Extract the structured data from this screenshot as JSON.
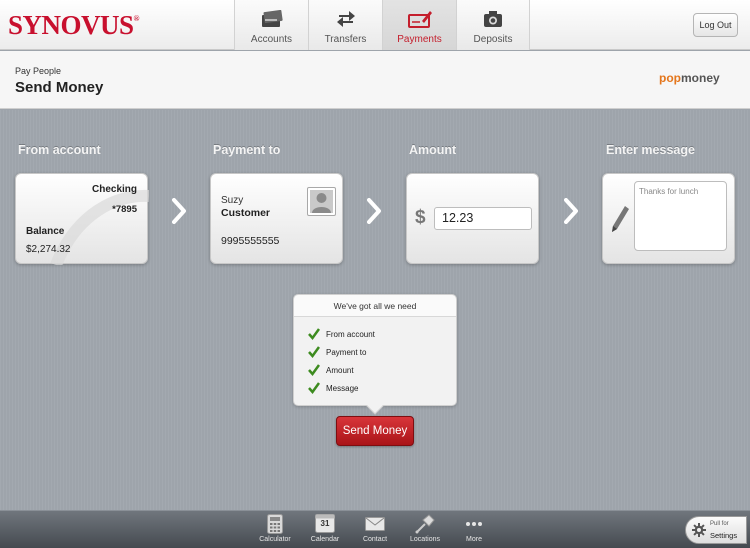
{
  "brand": {
    "logo": "SYNOVUS",
    "logo_mark": "®",
    "partner_logo_a": "pop",
    "partner_logo_b": "money"
  },
  "tabs": [
    {
      "label": "Accounts",
      "icon": "wallet-icon"
    },
    {
      "label": "Transfers",
      "icon": "transfer-arrows-icon"
    },
    {
      "label": "Payments",
      "icon": "check-pencil-icon",
      "active": true
    },
    {
      "label": "Deposits",
      "icon": "camera-icon"
    }
  ],
  "logout_label": "Log Out",
  "header": {
    "breadcrumb": "Pay People",
    "title": "Send Money"
  },
  "columns": {
    "from_label": "From account",
    "to_label": "Payment to",
    "amount_label": "Amount",
    "message_label": "Enter message"
  },
  "from_account": {
    "type": "Checking",
    "number": "*7895",
    "balance_label": "Balance",
    "balance": "$2,274.32"
  },
  "payee": {
    "first": "Suzy",
    "last": "Customer",
    "phone": "9995555555"
  },
  "amount": {
    "currency": "$",
    "value": "12.23"
  },
  "message": {
    "value": "Thanks for lunch"
  },
  "checklist": {
    "title": "We've got all we need",
    "items": [
      "From account",
      "Payment to",
      "Amount",
      "Message"
    ]
  },
  "send_button": "Send Money",
  "toolbar": {
    "items": [
      {
        "label": "Calculator",
        "icon": "calculator-icon"
      },
      {
        "label": "Calendar",
        "icon": "calendar-icon",
        "day": "31"
      },
      {
        "label": "Contact",
        "icon": "envelope-icon"
      },
      {
        "label": "Locations",
        "icon": "map-pin-icon"
      },
      {
        "label": "More",
        "icon": "more-dots-icon"
      }
    ],
    "settings_line1": "Pull for",
    "settings_line2": "Settings"
  },
  "colors": {
    "brand_red": "#c8102e",
    "accent_orange": "#e4761c",
    "button_red": "#c1282d"
  }
}
